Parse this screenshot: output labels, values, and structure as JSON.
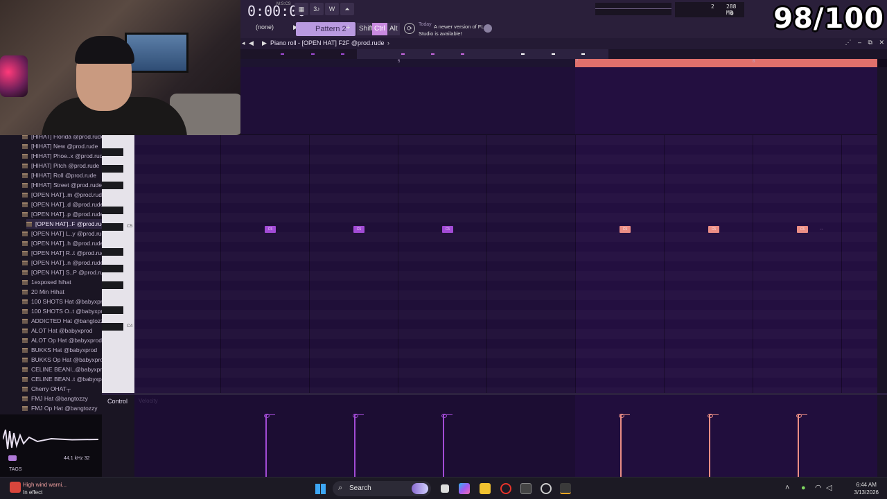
{
  "overlay": {
    "counter": "98/100"
  },
  "transport": {
    "time": "0:00:00",
    "time_unit": "M:S:CS",
    "cpu_top": "2",
    "ram": "288 MB",
    "cpu_bottom": "0"
  },
  "toolbar": {
    "snap": "(none)",
    "pattern": "Pattern 2",
    "pattern_plus": "+",
    "shift": "Shift",
    "ctrl": "Ctrl",
    "alt": "Alt",
    "hint_day": "Today",
    "hint_text": "A newer version of FL Studio is available!"
  },
  "piano_roll": {
    "title": "Piano roll - [OPEN HAT] F2F @prod.rude",
    "ruler": [
      "5",
      "7",
      "8"
    ],
    "key_c5": "C5",
    "key_c4": "C4",
    "note_label": "C5",
    "ghost_note": "↔",
    "control_label": "Control",
    "velocity_label": "Velocity",
    "notes": [
      {
        "step": 1,
        "color": "purple"
      },
      {
        "step": 2,
        "color": "purple"
      },
      {
        "step": 3,
        "color": "purple"
      },
      {
        "step": 5,
        "color": "salmon"
      },
      {
        "step": 6,
        "color": "salmon"
      },
      {
        "step": 7,
        "color": "salmon"
      }
    ],
    "colors": {
      "purple": "#a24bd6",
      "salmon": "#eb8e85",
      "loop": "#e0706c"
    }
  },
  "browser": {
    "items": [
      "[HIHAT] Florida @prod.rude",
      "[HIHAT] New @prod.rude",
      "[HIHAT] Phoe..x @prod.rude",
      "[HIHAT] Pitch @prod.rude",
      "[HIHAT] Roll @prod.rude",
      "[HIHAT] Street @prod.rude",
      "[OPEN HAT]..m @prod.rude",
      "[OPEN HAT]..d @prod.rude",
      "[OPEN HAT]..p @prod.rude",
      "[OPEN HAT]..F @prod.rude",
      "[OPEN HAT] L..y @prod.rude",
      "[OPEN HAT]..h @prod.rude",
      "[OPEN HAT] R..t @prod.rude",
      "[OPEN HAT]..n @prod.rude",
      "[OPEN HAT] S..P @prod.rude",
      "1exposed hihat",
      "20 Min Hihat",
      "100 SHOTS Hat @babyxprod",
      "100 SHOTS O..t @babyxprod",
      "ADDICTED Hat @bangtozzy",
      "ALOT Hat @babyxprod",
      "ALOT Op Hat @babyxprod",
      "BUKKS Hat @babyxprod",
      "BUKKS Op Hat @babyxprod",
      "CELINE BEANI..@babyxprod",
      "CELINE BEAN..t @babyxprod",
      "Cherry OHAT┬",
      "FMJ Hat @bangtozzy",
      "FMJ Op Hat @bangtozzy"
    ],
    "selected_index": 9,
    "sample_info": "44.1 kHz 32",
    "tags": "TAGS"
  },
  "taskbar": {
    "weather_line1": "High wind warni...",
    "weather_line2": "In effect",
    "search": "Search",
    "time": "6:44 AM",
    "date": "3/13/2026"
  }
}
